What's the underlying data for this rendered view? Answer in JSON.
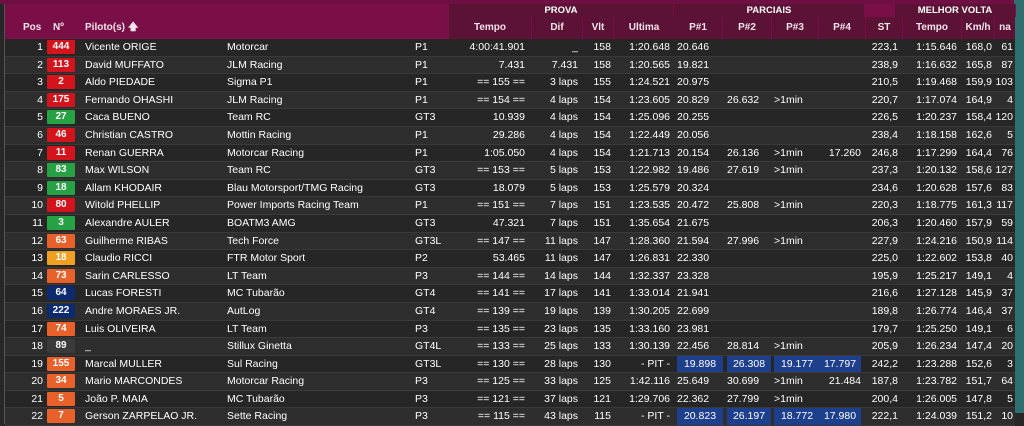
{
  "groups": {
    "prova": "PROVA",
    "parciais": "PARCIAIS",
    "melhor": "MELHOR VOLTA"
  },
  "headers": {
    "pos": "Pos",
    "num": "Nº",
    "piloto": "Piloto(s)",
    "sort_icon": "arrow-up-icon",
    "tempo": "Tempo",
    "dif": "Dif",
    "vlt": "Vlt",
    "ultima": "Ultima",
    "p1": "P#1",
    "p2": "P#2",
    "p3": "P#3",
    "p4": "P#4",
    "st": "ST",
    "mv_tempo": "Tempo",
    "kmh": "Km/h",
    "na": "na"
  },
  "colors": {
    "red": "#d4141c",
    "green": "#26a244",
    "orange": "#e8602a",
    "yellow": "#f0a020",
    "darkblue": "#0c2a6e",
    "white": "#ffffff"
  },
  "rows": [
    {
      "pos": "1",
      "num": "444",
      "numColor": "#d4141c",
      "piloto": "Vicente ORIGE",
      "equipe": "Motorcar",
      "cat": "P1",
      "tempo": "4:00:41.901",
      "dif": "_",
      "vlt": "158",
      "ultima": "1:20.648",
      "p1": "20.646",
      "p2": "",
      "p3": "",
      "p4": "",
      "st": "223,1",
      "mv": "1:15.646",
      "kmh": "168,0",
      "na": "61",
      "blue": false
    },
    {
      "pos": "2",
      "num": "113",
      "numColor": "#d4141c",
      "piloto": "David MUFFATO",
      "equipe": "JLM Racing",
      "cat": "P1",
      "tempo": "7.431",
      "dif": "7.431",
      "vlt": "158",
      "ultima": "1:20.565",
      "p1": "19.821",
      "p2": "",
      "p3": "",
      "p4": "",
      "st": "238,9",
      "mv": "1:16.632",
      "kmh": "165,8",
      "na": "87",
      "blue": false
    },
    {
      "pos": "3",
      "num": "2",
      "numColor": "#d4141c",
      "piloto": "Aldo PIEDADE",
      "equipe": "Sigma P1",
      "cat": "P1",
      "tempo": "== 155 ==",
      "dif": "3 laps",
      "vlt": "155",
      "ultima": "1:24.521",
      "p1": "20.975",
      "p2": "",
      "p3": "",
      "p4": "",
      "st": "210,5",
      "mv": "1:19.468",
      "kmh": "159,9",
      "na": "103",
      "blue": false
    },
    {
      "pos": "4",
      "num": "175",
      "numColor": "#d4141c",
      "piloto": "Fernando OHASHI",
      "equipe": "JLM Racing",
      "cat": "P1",
      "tempo": "== 154 ==",
      "dif": "4 laps",
      "vlt": "154",
      "ultima": "1:23.605",
      "p1": "20.829",
      "p2": "26.632",
      "p3": ">1min",
      "p4": "",
      "st": "220,7",
      "mv": "1:17.074",
      "kmh": "164,9",
      "na": "4",
      "blue": false
    },
    {
      "pos": "5",
      "num": "27",
      "numColor": "#26a244",
      "piloto": "Caca BUENO",
      "equipe": "Team RC",
      "cat": "GT3",
      "tempo": "10.939",
      "dif": "4 laps",
      "vlt": "154",
      "ultima": "1:25.096",
      "p1": "20.255",
      "p2": "",
      "p3": "",
      "p4": "",
      "st": "226,5",
      "mv": "1:20.237",
      "kmh": "158,4",
      "na": "120",
      "blue": false
    },
    {
      "pos": "6",
      "num": "46",
      "numColor": "#d4141c",
      "piloto": "Christian CASTRO",
      "equipe": "Mottin Racing",
      "cat": "P1",
      "tempo": "29.286",
      "dif": "4 laps",
      "vlt": "154",
      "ultima": "1:22.449",
      "p1": "20.056",
      "p2": "",
      "p3": "",
      "p4": "",
      "st": "238,4",
      "mv": "1:18.158",
      "kmh": "162,6",
      "na": "5",
      "blue": false
    },
    {
      "pos": "7",
      "num": "11",
      "numColor": "#d4141c",
      "piloto": "Renan GUERRA",
      "equipe": "Motorcar Racing",
      "cat": "P1",
      "tempo": "1:05.050",
      "dif": "4 laps",
      "vlt": "154",
      "ultima": "1:21.713",
      "p1": "20.154",
      "p2": "26.136",
      "p3": ">1min",
      "p4": "17.260",
      "st": "246,8",
      "mv": "1:17.299",
      "kmh": "164,4",
      "na": "76",
      "blue": false
    },
    {
      "pos": "8",
      "num": "83",
      "numColor": "#26a244",
      "piloto": "Max WILSON",
      "equipe": "Team RC",
      "cat": "GT3",
      "tempo": "== 153 ==",
      "dif": "5 laps",
      "vlt": "153",
      "ultima": "1:22.982",
      "p1": "19.486",
      "p2": "27.619",
      "p3": ">1min",
      "p4": "",
      "st": "237,3",
      "mv": "1:20.132",
      "kmh": "158,6",
      "na": "127",
      "blue": false
    },
    {
      "pos": "9",
      "num": "18",
      "numColor": "#26a244",
      "piloto": "Allam KHODAIR",
      "equipe": "Blau Motorsport/TMG Racing",
      "cat": "GT3",
      "tempo": "18.079",
      "dif": "5 laps",
      "vlt": "153",
      "ultima": "1:25.579",
      "p1": "20.324",
      "p2": "",
      "p3": "",
      "p4": "",
      "st": "234,6",
      "mv": "1:20.628",
      "kmh": "157,6",
      "na": "83",
      "blue": false
    },
    {
      "pos": "10",
      "num": "80",
      "numColor": "#d4141c",
      "piloto": "Witold PHELLIP",
      "equipe": "Power Imports Racing Team",
      "cat": "P1",
      "tempo": "== 151 ==",
      "dif": "7 laps",
      "vlt": "151",
      "ultima": "1:23.535",
      "p1": "20.472",
      "p2": "25.808",
      "p3": ">1min",
      "p4": "",
      "st": "220,3",
      "mv": "1:18.775",
      "kmh": "161,3",
      "na": "117",
      "blue": false
    },
    {
      "pos": "11",
      "num": "3",
      "numColor": "#26a244",
      "piloto": "Alexandre AULER",
      "equipe": "BOATM3 AMG",
      "cat": "GT3",
      "tempo": "47.321",
      "dif": "7 laps",
      "vlt": "151",
      "ultima": "1:35.654",
      "p1": "21.675",
      "p2": "",
      "p3": "",
      "p4": "",
      "st": "206,3",
      "mv": "1:20.460",
      "kmh": "157,9",
      "na": "59",
      "blue": false
    },
    {
      "pos": "12",
      "num": "63",
      "numColor": "#e8602a",
      "piloto": "Guilherme RIBAS",
      "equipe": "Tech Force",
      "cat": "GT3L",
      "tempo": "== 147 ==",
      "dif": "11 laps",
      "vlt": "147",
      "ultima": "1:28.360",
      "p1": "21.594",
      "p2": "27.996",
      "p3": ">1min",
      "p4": "",
      "st": "227,9",
      "mv": "1:24.216",
      "kmh": "150,9",
      "na": "114",
      "blue": false
    },
    {
      "pos": "13",
      "num": "18",
      "numColor": "#f0a020",
      "piloto": "Claudio RICCI",
      "equipe": "FTR Motor Sport",
      "cat": "P2",
      "tempo": "53.465",
      "dif": "11 laps",
      "vlt": "147",
      "ultima": "1:26.831",
      "p1": "22.330",
      "p2": "",
      "p3": "",
      "p4": "",
      "st": "225,0",
      "mv": "1:22.602",
      "kmh": "153,8",
      "na": "40",
      "blue": false
    },
    {
      "pos": "14",
      "num": "73",
      "numColor": "#e8602a",
      "piloto": "Sarin CARLESSO",
      "equipe": "LT Team",
      "cat": "P3",
      "tempo": "== 144 ==",
      "dif": "14 laps",
      "vlt": "144",
      "ultima": "1:32.337",
      "p1": "23.328",
      "p2": "",
      "p3": "",
      "p4": "",
      "st": "195,9",
      "mv": "1:25.217",
      "kmh": "149,1",
      "na": "4",
      "blue": false
    },
    {
      "pos": "15",
      "num": "64",
      "numColor": "#0c2a6e",
      "piloto": "Lucas FORESTI",
      "equipe": "MC Tubarão",
      "cat": "GT4",
      "tempo": "== 141 ==",
      "dif": "17 laps",
      "vlt": "141",
      "ultima": "1:33.014",
      "p1": "21.941",
      "p2": "",
      "p3": "",
      "p4": "",
      "st": "216,6",
      "mv": "1:27.128",
      "kmh": "145,9",
      "na": "37",
      "blue": false
    },
    {
      "pos": "16",
      "num": "222",
      "numColor": "#0c2a6e",
      "piloto": "Andre MORAES JR.",
      "equipe": "AutLog",
      "cat": "GT4",
      "tempo": "== 139 ==",
      "dif": "19 laps",
      "vlt": "139",
      "ultima": "1:30.205",
      "p1": "22.699",
      "p2": "",
      "p3": "",
      "p4": "",
      "st": "189,8",
      "mv": "1:26.774",
      "kmh": "146,4",
      "na": "37",
      "blue": false
    },
    {
      "pos": "17",
      "num": "74",
      "numColor": "#e8602a",
      "piloto": "Luis OLIVEIRA",
      "equipe": "LT Team",
      "cat": "P3",
      "tempo": "== 135 ==",
      "dif": "23 laps",
      "vlt": "135",
      "ultima": "1:33.160",
      "p1": "23.981",
      "p2": "",
      "p3": "",
      "p4": "",
      "st": "179,7",
      "mv": "1:25.250",
      "kmh": "149,1",
      "na": "6",
      "blue": false
    },
    {
      "pos": "18",
      "num": "89",
      "numColor": "#3a3a3a",
      "piloto": "_",
      "equipe": "Stillux Ginetta",
      "cat": "GT4L",
      "tempo": "== 133 ==",
      "dif": "25 laps",
      "vlt": "133",
      "ultima": "1:30.139",
      "p1": "22.456",
      "p2": "28.814",
      "p3": ">1min",
      "p4": "",
      "st": "205,9",
      "mv": "1:26.234",
      "kmh": "147,4",
      "na": "20",
      "blue": false
    },
    {
      "pos": "19",
      "num": "155",
      "numColor": "#e8602a",
      "piloto": "Marcal MULLER",
      "equipe": "Sul Racing",
      "cat": "GT3L",
      "tempo": "== 130 ==",
      "dif": "28 laps",
      "vlt": "130",
      "ultima": "- PIT -",
      "p1": "19.898",
      "p2": "26.308",
      "p3": "19.177",
      "p4": "17.797",
      "st": "242,2",
      "mv": "1:23.288",
      "kmh": "152,6",
      "na": "3",
      "blue": true
    },
    {
      "pos": "20",
      "num": "34",
      "numColor": "#e8602a",
      "piloto": "Mario MARCONDES",
      "equipe": "Motorcar Racing",
      "cat": "P3",
      "tempo": "== 125 ==",
      "dif": "33 laps",
      "vlt": "125",
      "ultima": "1:42.116",
      "p1": "25.649",
      "p2": "30.699",
      "p3": ">1min",
      "p4": "21.484",
      "st": "187,8",
      "mv": "1:23.782",
      "kmh": "151,7",
      "na": "64",
      "blue": false
    },
    {
      "pos": "21",
      "num": "5",
      "numColor": "#e8602a",
      "piloto": "João P. MAIA",
      "equipe": "MC Tubarão",
      "cat": "P3",
      "tempo": "== 121 ==",
      "dif": "37 laps",
      "vlt": "121",
      "ultima": "1:29.706",
      "p1": "22.362",
      "p2": "27.799",
      "p3": ">1min",
      "p4": "",
      "st": "200,4",
      "mv": "1:26.005",
      "kmh": "147,8",
      "na": "5",
      "blue": false
    },
    {
      "pos": "22",
      "num": "7",
      "numColor": "#e8602a",
      "piloto": "Gerson ZARPELAO JR.",
      "equipe": "Sette Racing",
      "cat": "P3",
      "tempo": "== 115 ==",
      "dif": "43 laps",
      "vlt": "115",
      "ultima": "- PIT -",
      "p1": "20.823",
      "p2": "26.197",
      "p3": "18.772",
      "p4": "17.980",
      "st": "222,1",
      "mv": "1:24.039",
      "kmh": "151,2",
      "na": "10",
      "blue": true
    }
  ]
}
